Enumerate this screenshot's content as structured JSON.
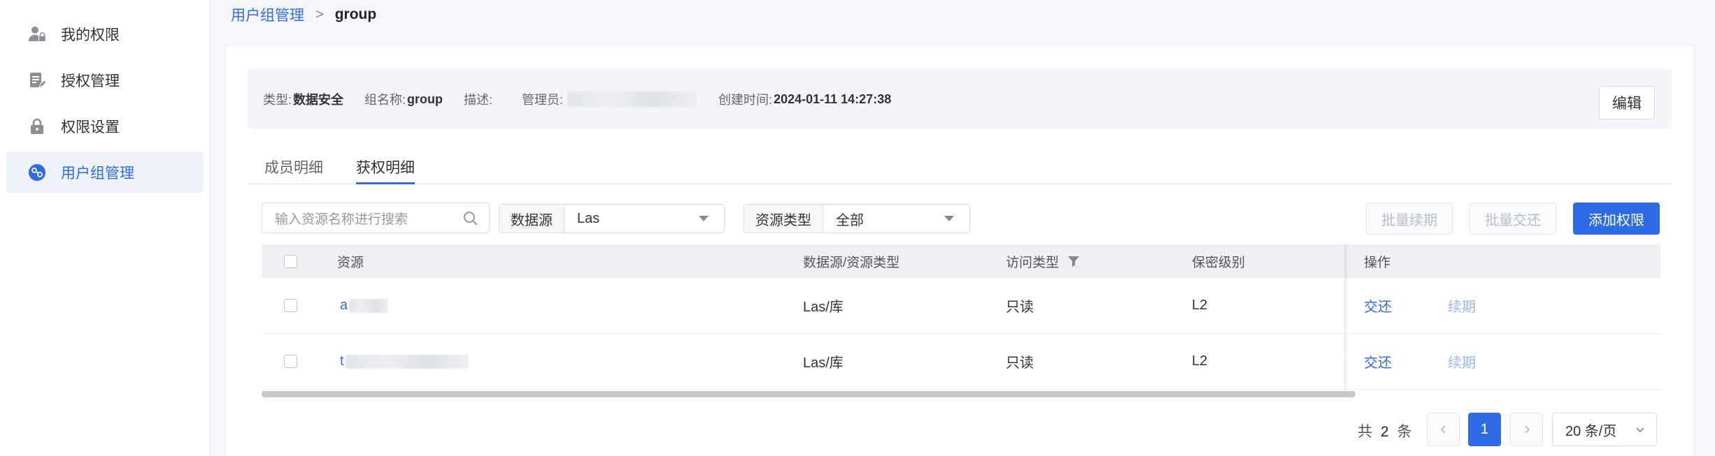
{
  "sidebar": {
    "items": [
      {
        "label": "我的权限",
        "icon": "user-lock-icon"
      },
      {
        "label": "授权管理",
        "icon": "document-edit-icon"
      },
      {
        "label": "权限设置",
        "icon": "lock-icon"
      },
      {
        "label": "用户组管理",
        "icon": "user-group-icon",
        "active": true
      }
    ]
  },
  "breadcrumb": {
    "parent": "用户组管理",
    "separator": ">",
    "current": "group"
  },
  "info": {
    "type_label": "类型:",
    "type_value": "数据安全",
    "name_label": "组名称:",
    "name_value": "group",
    "desc_label": "描述:",
    "desc_value": "",
    "admin_label": "管理员:",
    "created_label": "创建时间:",
    "created_value": "2024-01-11 14:27:38",
    "edit_button": "编辑"
  },
  "tabs": [
    {
      "label": "成员明细",
      "active": false
    },
    {
      "label": "获权明细",
      "active": true
    }
  ],
  "toolbar": {
    "search_placeholder": "输入资源名称进行搜索",
    "datasource_label": "数据源",
    "datasource_value": "Las",
    "resource_type_label": "资源类型",
    "resource_type_value": "全部",
    "batch_renew": "批量续期",
    "batch_return": "批量交还",
    "add_permission": "添加权限"
  },
  "table": {
    "columns": [
      "资源",
      "数据源/资源类型",
      "访问类型",
      "保密级别",
      "操作"
    ],
    "rows": [
      {
        "resource_prefix": "a",
        "source_type": "Las/库",
        "access": "只读",
        "level": "L2",
        "action_return": "交还",
        "action_renew": "续期"
      },
      {
        "resource_prefix": "t",
        "source_type": "Las/库",
        "access": "只读",
        "level": "L2",
        "action_return": "交还",
        "action_renew": "续期"
      }
    ]
  },
  "pagination": {
    "total_prefix": "共",
    "total_count": "2",
    "total_suffix": "条",
    "current_page": "1",
    "page_size": "20 条/页"
  },
  "colors": {
    "accent": "#2e6be6",
    "sidebar_active_bg": "#eef2fb",
    "info_bg": "#f3f5fb"
  }
}
